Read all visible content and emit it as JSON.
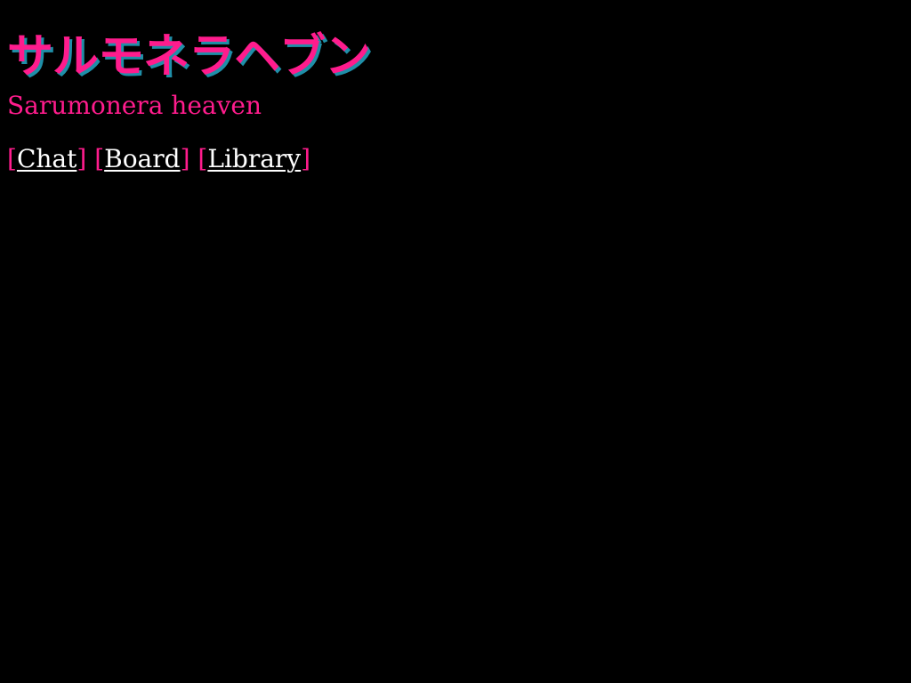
{
  "header": {
    "title": "サルモネラヘブン",
    "subtitle": "Sarumonera heaven"
  },
  "nav": {
    "items": [
      {
        "label": "Chat"
      },
      {
        "label": "Board"
      },
      {
        "label": "Library"
      }
    ]
  },
  "colors": {
    "background": "#000000",
    "accent": "#ff1c8d",
    "title_shadow": "#1f8fa8",
    "link": "#ffffff"
  }
}
